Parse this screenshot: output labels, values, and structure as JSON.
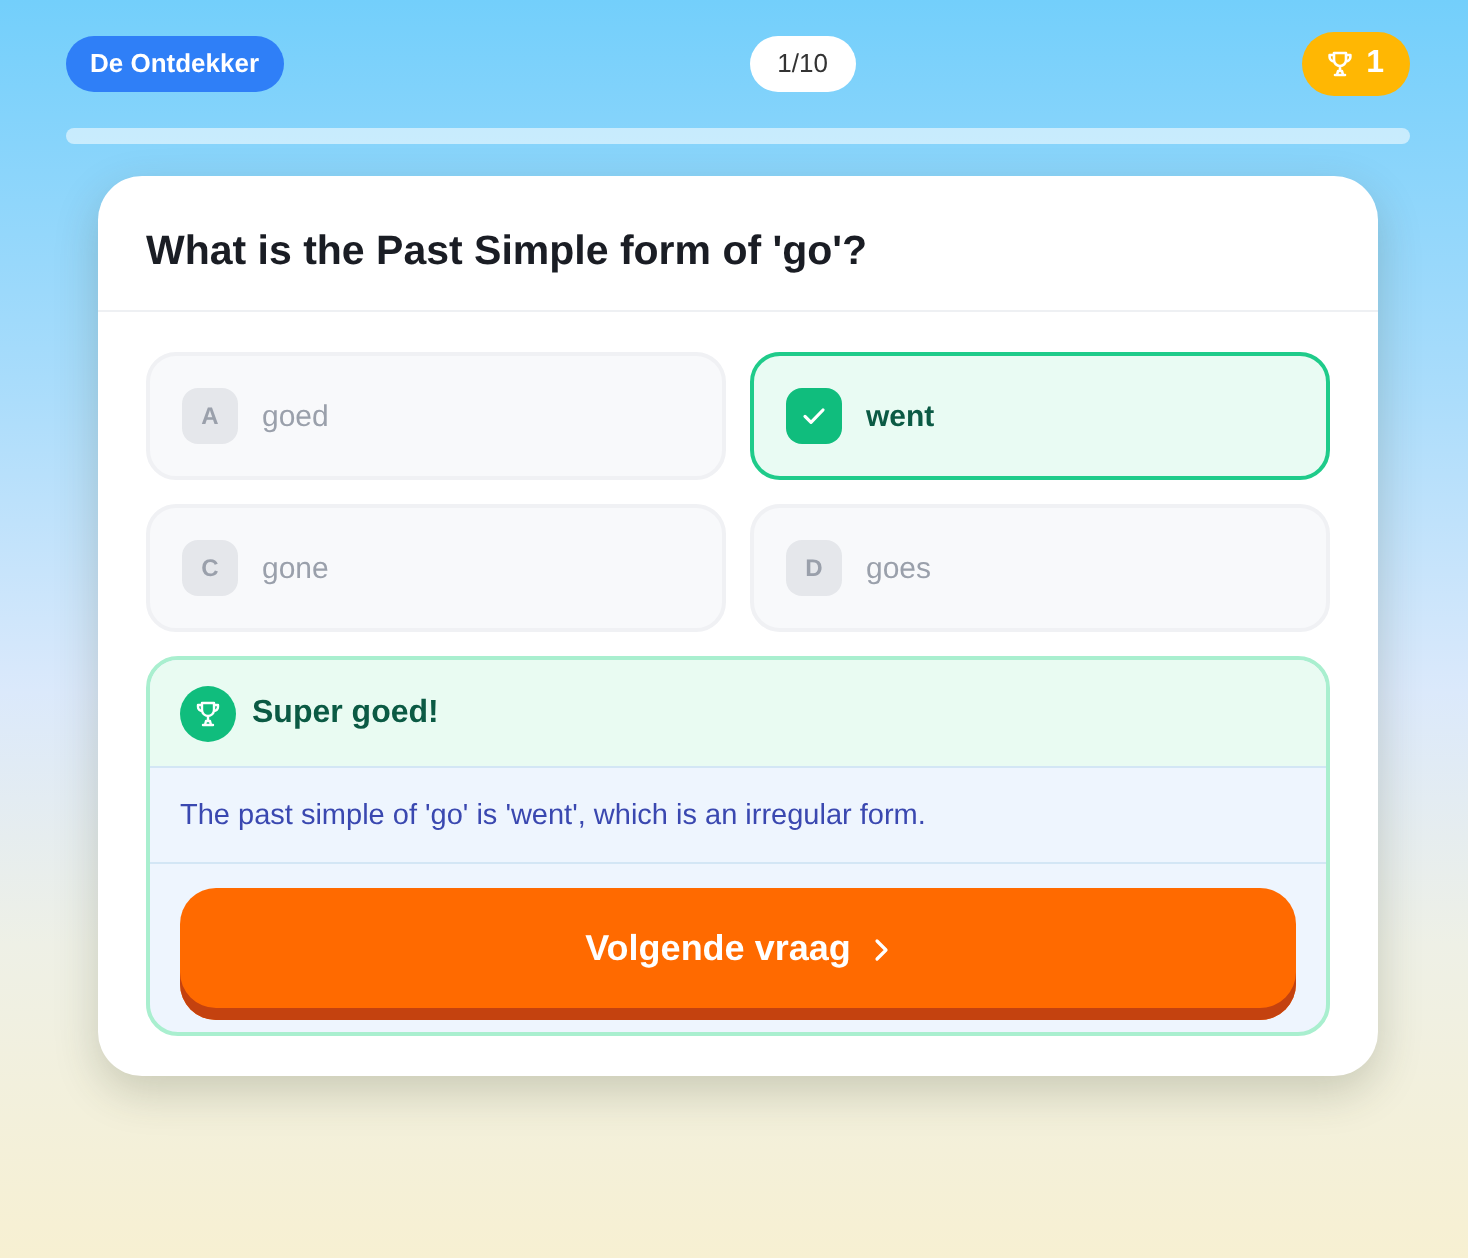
{
  "header": {
    "badge": "De Ontdekker",
    "counter": "1/10",
    "score": "1"
  },
  "question": "What is the Past Simple form of 'go'?",
  "options": [
    {
      "letter": "A",
      "text": "goed",
      "selected": false
    },
    {
      "text": "went",
      "selected": true
    },
    {
      "letter": "C",
      "text": "gone",
      "selected": false
    },
    {
      "letter": "D",
      "text": "goes",
      "selected": false
    }
  ],
  "feedback": {
    "kind": "correct",
    "title": "Super goed!",
    "explanation": "The past simple of 'go' is 'went', which is an irregular form.",
    "button": "Volgende vraag"
  }
}
